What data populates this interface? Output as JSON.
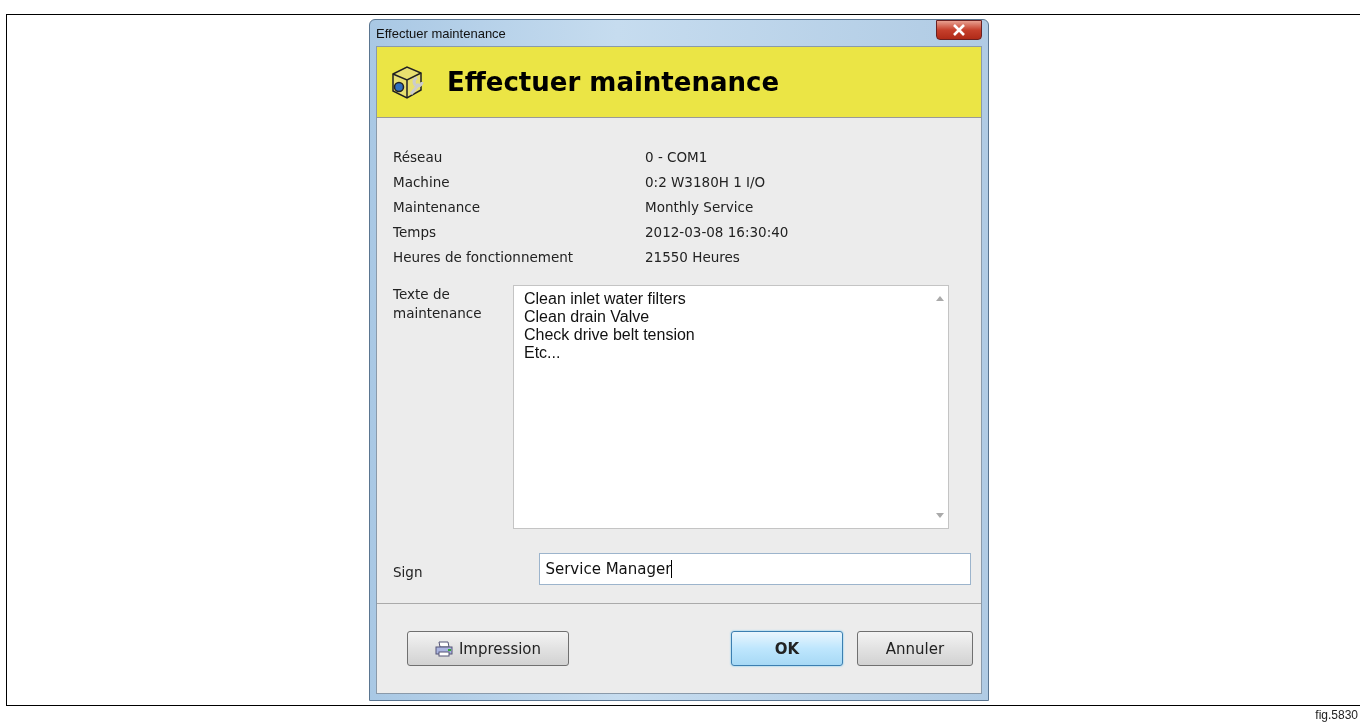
{
  "window": {
    "title": "Effectuer maintenance"
  },
  "header": {
    "title": "Effectuer maintenance"
  },
  "info_rows": [
    {
      "label": "Réseau",
      "value": "0 - COM1"
    },
    {
      "label": "Machine",
      "value": "0:2 W3180H 1 I/O"
    },
    {
      "label": "Maintenance",
      "value": "Monthly Service"
    },
    {
      "label": "Temps",
      "value": "2012-03-08 16:30:40"
    },
    {
      "label": "Heures de fonctionnement",
      "value": "21550 Heures"
    }
  ],
  "maintenance_text": {
    "label": "Texte de maintenance",
    "lines": [
      "Clean inlet water filters",
      "Clean drain Valve",
      "Check drive belt tension",
      "Etc..."
    ]
  },
  "sign": {
    "label": "Sign",
    "value": "Service Manager"
  },
  "buttons": [
    {
      "label": "Impression",
      "kind": "print"
    },
    {
      "label": "OK",
      "kind": "default"
    },
    {
      "label": "Annuler",
      "kind": "plain"
    }
  ],
  "figure_label": "fig.5830"
}
